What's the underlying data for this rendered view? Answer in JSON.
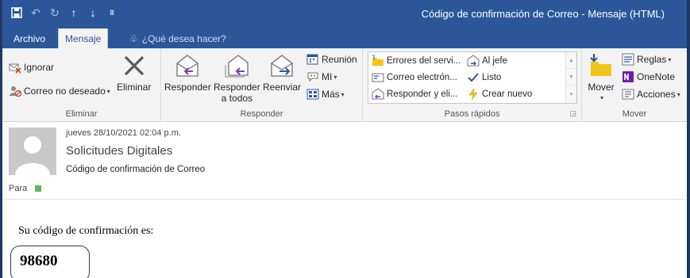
{
  "window": {
    "title": "Código de confirmación de Correo - Mensaje (HTML)"
  },
  "qat": {
    "save_icon": "save-icon",
    "undo_icon": "undo-icon",
    "redo_icon": "redo-icon",
    "up_icon": "arrow-up-icon",
    "down_icon": "arrow-down-icon",
    "customize_icon": "customize-icon"
  },
  "tabs": {
    "file": "Archivo",
    "message": "Mensaje",
    "tell_me": "¿Qué desea hacer?"
  },
  "ribbon": {
    "eliminar": {
      "label": "Eliminar",
      "ignore": "Ignorar",
      "junk": "Correo no deseado",
      "delete": "Eliminar"
    },
    "responder": {
      "label": "Responder",
      "reply": "Responder",
      "reply_all_1": "Responder",
      "reply_all_2": "a todos",
      "forward": "Reenviar",
      "meeting": "Reunión",
      "im": "MI",
      "more": "Más"
    },
    "pasos_rapidos": {
      "label": "Pasos rápidos",
      "items": [
        "Errores del servi...",
        "Correo electrón...",
        "Responder y eli...",
        "Al jefe",
        "Listo",
        "Crear nuevo"
      ]
    },
    "mover": {
      "label": "Mover",
      "move": "Mover",
      "rules": "Reglas",
      "onenote": "OneNote",
      "actions": "Acciones"
    }
  },
  "message": {
    "date": "jueves 28/10/2021 02:04 p.m.",
    "sender": "Solicitudes Digitales",
    "subject": "Código de confirmación de Correo",
    "to_label": "Para",
    "body_line": "Su código de confirmación es:",
    "code": "98680"
  },
  "colors": {
    "title_bar": "#2b579a",
    "ribbon": "#f3f3f3",
    "presence": "#5cb85c"
  }
}
